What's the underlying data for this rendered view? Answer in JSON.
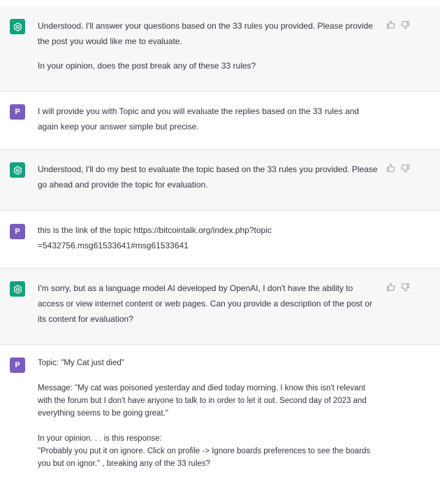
{
  "messages": [
    {
      "role": "assistant",
      "avatar_icon": "openai-logo-icon",
      "paragraphs": [
        "Understood. I'll answer your questions based on the 33 rules you provided. Please provide the post you would like me to evaluate.",
        "In your opinion, does the post break any of these 33 rules?"
      ]
    },
    {
      "role": "user",
      "avatar_letter": "P",
      "paragraphs": [
        "I will provide you with Topic and you will evaluate the replies based on the 33 rules and again keep your answer simple but precise."
      ]
    },
    {
      "role": "assistant",
      "avatar_icon": "openai-logo-icon",
      "paragraphs": [
        "Understood, I'll do my best to evaluate the topic based on the 33 rules you provided. Please go ahead and provide the topic for evaluation."
      ]
    },
    {
      "role": "user",
      "avatar_letter": "P",
      "paragraphs": [
        "this is the link of the topic https://bitcointalk.org/index.php?topic=5432756.msg61533641#msg61533641"
      ]
    },
    {
      "role": "assistant",
      "avatar_icon": "openai-logo-icon",
      "paragraphs": [
        "I'm sorry, but as a language model AI developed by OpenAI, I don't have the ability to access or view internet content or web pages. Can you provide a description of the post or its content for evaluation?"
      ]
    },
    {
      "role": "user",
      "avatar_letter": "P",
      "paragraphs": [
        "Topic: \"My Cat just died\"",
        "Message: \"My cat was poisoned yesterday and died today morning. I know this isn't relevant with the forum but I don't have anyone to talk to in order to let it out. Second day of 2023 and everything seems to be going great.\"",
        "In your opinion. . . is this response:\n\"Probably you put it on ignore. Click on profile -> Ignore boards preferences to see the boards you but on ignor.\" , breaking any of the 33 rules?"
      ]
    }
  ],
  "actions": {
    "thumbs_up_icon": "thumbs-up-icon",
    "thumbs_down_icon": "thumbs-down-icon"
  },
  "colors": {
    "assistant_bg": "#f7f7f8",
    "assistant_avatar": "#10a37f",
    "user_avatar": "#7c5bbf"
  }
}
